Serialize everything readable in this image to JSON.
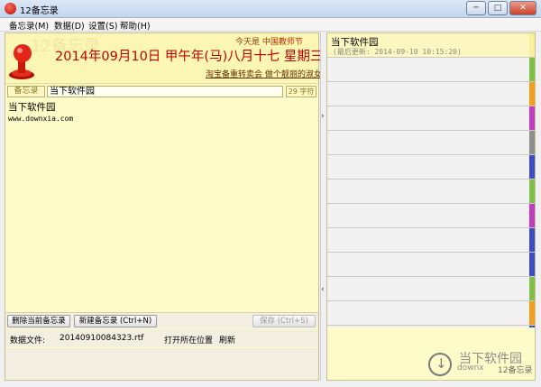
{
  "window": {
    "title": "12备忘录",
    "minimize": "─",
    "maximize": "□",
    "close": "✕"
  },
  "menu": [
    {
      "label": "备忘录(M)"
    },
    {
      "label": "数据(D)"
    },
    {
      "label": "设置(S)"
    },
    {
      "label": "帮助(H)"
    }
  ],
  "header": {
    "watermark": "12备忘录",
    "holiday_prefix": "今天是",
    "holiday_name": "中国教师节",
    "date_line": "2014年09月10日 甲午年(马)八月十七 星期三",
    "promo_link": "淘宝备重转卖会 做个靓丽的淑女"
  },
  "note": {
    "tag_label": "备忘录",
    "title": "当下软件园",
    "char_count": "29 字符",
    "content_title": "当下软件园",
    "content_body": "www.downxia.com"
  },
  "buttons": {
    "delete": "删除当前备忘录",
    "new": "新建备忘录 (Ctrl+N)",
    "save": "保存 (Ctrl+S)"
  },
  "file": {
    "label": "数据文件:",
    "name": "20140910084323.rtf",
    "open_location": "打开所在位置",
    "refresh": "刷新"
  },
  "list": {
    "first": {
      "title": "当下软件园",
      "updated": "(最后更新: 2014-09-10 10:15:20)",
      "color": "#f7ef9a"
    },
    "stripe_colors": [
      "#7fc04a",
      "#f59d1c",
      "#c03cc0",
      "#8e8e8e",
      "#3c4cc8",
      "#7fc04a",
      "#c03cc0",
      "#3c4cc8",
      "#3c4cc8",
      "#7fc04a",
      "#f59d1c",
      "#3c4cc8"
    ]
  },
  "branding": {
    "main": "当下软件园",
    "sub": "downx",
    "app": "12备忘录"
  }
}
